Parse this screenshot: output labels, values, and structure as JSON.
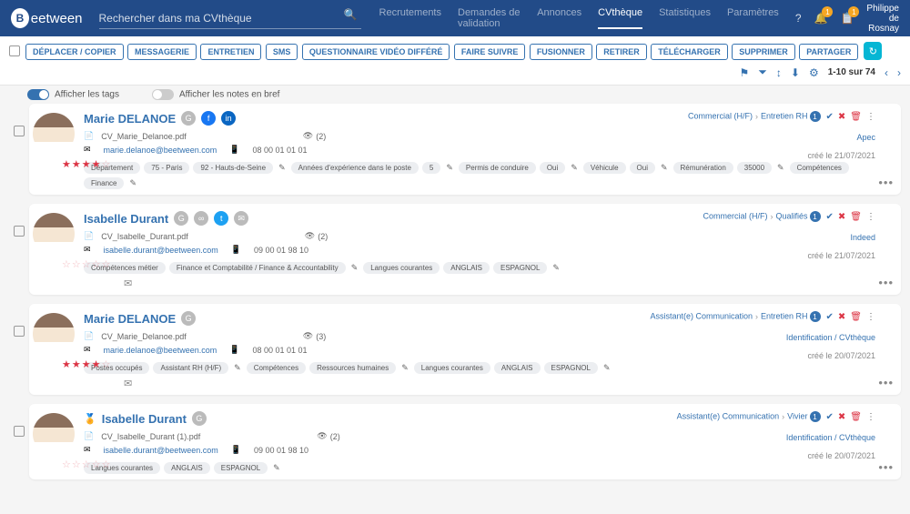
{
  "brand": {
    "letter": "B",
    "name": "eetween"
  },
  "search": {
    "placeholder": "Rechercher dans ma CVthèque"
  },
  "nav": [
    {
      "label": "Recrutements"
    },
    {
      "label": "Demandes de validation"
    },
    {
      "label": "Annonces"
    },
    {
      "label": "CVthèque",
      "active": true
    },
    {
      "label": "Statistiques"
    },
    {
      "label": "Paramètres"
    }
  ],
  "notifications": {
    "bell": "1",
    "task": "1"
  },
  "user": {
    "first": "Philippe",
    "last": "de Rosnay"
  },
  "actions": [
    "DÉPLACER / COPIER",
    "MESSAGERIE",
    "ENTRETIEN",
    "SMS",
    "QUESTIONNAIRE VIDÉO DIFFÉRÉ",
    "FAIRE SUIVRE",
    "FUSIONNER",
    "RETIRER",
    "TÉLÉCHARGER",
    "SUPPRIMER",
    "PARTAGER"
  ],
  "count": "1-10 sur 74",
  "toggles": {
    "tags": "Afficher les tags",
    "notes": "Afficher les notes en bref"
  },
  "cards": [
    {
      "name": "Marie DELANOE",
      "socials": [
        "g",
        "fb",
        "li"
      ],
      "cv": "CV_Marie_Delanoe.pdf",
      "views": "(2)",
      "rating": 4,
      "email": "marie.delanoe@beetween.com",
      "phone": "08 00 01 01 01",
      "tagGroups": [
        {
          "key": "Département",
          "vals": [
            "75 - Paris",
            "92 - Hauts-de-Seine"
          ]
        },
        {
          "key": "Années d'expérience dans le poste",
          "vals": [
            "5"
          ]
        },
        {
          "key": "Permis de conduire",
          "vals": [
            "Oui"
          ]
        },
        {
          "key": "Véhicule",
          "vals": [
            "Oui"
          ]
        },
        {
          "key": "Rémunération",
          "vals": [
            "35000"
          ]
        },
        {
          "key": "Compétences",
          "vals": [
            "Finance"
          ]
        }
      ],
      "path": [
        "Commercial (H/F)",
        "Entretien RH"
      ],
      "pathCount": "1",
      "source": "Apec",
      "created": "créé le 21/07/2021",
      "env": false
    },
    {
      "name": "Isabelle Durant",
      "socials": [
        "g",
        "g2",
        "tw",
        "g3"
      ],
      "cv": "CV_Isabelle_Durant.pdf",
      "views": "(2)",
      "rating": 0,
      "email": "isabelle.durant@beetween.com",
      "phone": "09 00 01 98 10",
      "tagGroups": [
        {
          "key": "Compétences métier",
          "vals": [
            "Finance et Comptabilité / Finance & Accountability"
          ]
        },
        {
          "key": "Langues courantes",
          "vals": [
            "ANGLAIS",
            "ESPAGNOL"
          ]
        }
      ],
      "path": [
        "Commercial (H/F)",
        "Qualifiés"
      ],
      "pathCount": "1",
      "source": "Indeed",
      "created": "créé le 21/07/2021",
      "env": true
    },
    {
      "name": "Marie DELANOE",
      "socials": [
        "g"
      ],
      "cv": "CV_Marie_Delanoe.pdf",
      "views": "(3)",
      "rating": 4,
      "email": "marie.delanoe@beetween.com",
      "phone": "08 00 01 01 01",
      "tagGroups": [
        {
          "key": "Postes occupés",
          "vals": [
            "Assistant RH (H/F)"
          ]
        },
        {
          "key": "Compétences",
          "vals": [
            "Ressources humaines"
          ]
        },
        {
          "key": "Langues courantes",
          "vals": [
            "ANGLAIS",
            "ESPAGNOL"
          ]
        }
      ],
      "path": [
        "Assistant(e) Communication",
        "Entretien RH"
      ],
      "pathCount": "1",
      "source": "Identification / CVthèque",
      "created": "créé le 20/07/2021",
      "env": true
    },
    {
      "name": "Isabelle Durant",
      "award": true,
      "socials": [
        "g"
      ],
      "cv": "CV_Isabelle_Durant (1).pdf",
      "views": "(2)",
      "rating": 0,
      "email": "isabelle.durant@beetween.com",
      "phone": "09 00 01 98 10",
      "tagGroups": [
        {
          "key": "Langues courantes",
          "vals": [
            "ANGLAIS",
            "ESPAGNOL"
          ]
        }
      ],
      "path": [
        "Assistant(e) Communication",
        "Vivier"
      ],
      "pathCount": "1",
      "source": "Identification / CVthèque",
      "created": "créé le 20/07/2021",
      "env": false
    }
  ]
}
